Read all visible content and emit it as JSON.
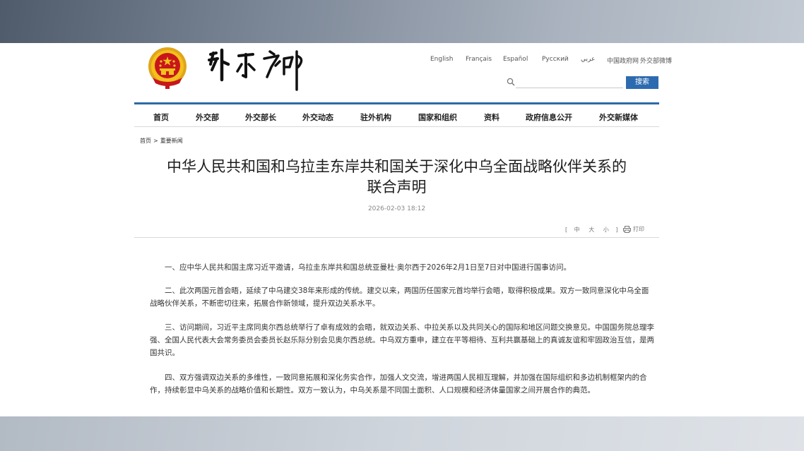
{
  "header": {
    "logo_text": "外交部",
    "languages": [
      "English",
      "Français",
      "Español",
      "Русский",
      "عربي",
      "中国政府网",
      "外交部微博"
    ]
  },
  "search": {
    "placeholder": "",
    "button_label": "搜索"
  },
  "nav": {
    "items": [
      "首页",
      "外交部",
      "外交部长",
      "外交动态",
      "驻外机构",
      "国家和组织",
      "资料",
      "政府信息公开",
      "外交新媒体"
    ]
  },
  "breadcrumb": {
    "home": "首页",
    "separator": ">",
    "current": "重要新闻"
  },
  "article": {
    "title_line1": "中华人民共和国和乌拉圭东岸共和国关于深化中乌全面战略伙伴关系的",
    "title_line2": "联合声明",
    "date": "2026-02-03 18:12",
    "font_size_options": [
      "中",
      "大",
      "小"
    ],
    "font_size_brackets": [
      "[",
      "]"
    ],
    "print_label": "打印",
    "paragraphs": [
      "一、应中华人民共和国主席习近平邀请，乌拉圭东岸共和国总统亚曼杜·奥尔西于2026年2月1日至7日对中国进行国事访问。",
      "二、此次两国元首会晤，延续了中乌建交38年来形成的传统。建交以来，两国历任国家元首均举行会晤，取得积极成果。双方一致同意深化中乌全面战略伙伴关系，不断密切往来，拓展合作新领域，提升双边关系水平。",
      "三、访问期间，习近平主席同奥尔西总统举行了卓有成效的会晤，就双边关系、中拉关系以及共同关心的国际和地区问题交换意见。中国国务院总理李强、全国人民代表大会常务委员会委员长赵乐际分别会见奥尔西总统。中乌双方重申，建立在平等相待、互利共赢基础上的真诚友谊和牢固政治互信，是两国共识。",
      "四、双方强调双边关系的多维性，一致同意拓展和深化务实合作，加强人文交流，增进两国人民相互理解，并加强在国际组织和多边机制框架内的合作，持续彰显中乌关系的战略价值和长期性。双方一致认为，中乌关系是不同国土面积、人口规模和经济体量国家之间开展合作的典范。"
    ]
  },
  "colors": {
    "accent": "#2d6bb0",
    "emblem_red": "#c8161d",
    "emblem_gold": "#f3c01c"
  }
}
